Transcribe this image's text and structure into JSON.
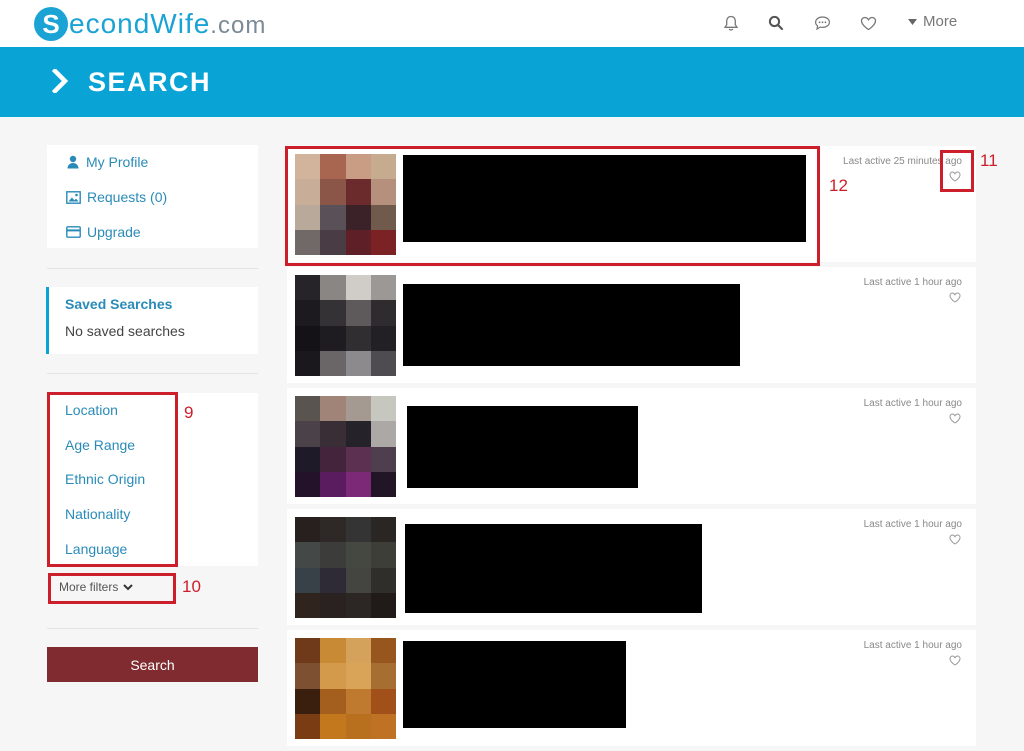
{
  "header": {
    "logo_letter": "S",
    "logo_text": "econdWife",
    "logo_suffix": ".com",
    "icons": [
      "bell-icon",
      "search-icon",
      "chat-icon",
      "heart-icon"
    ],
    "more_label": "More"
  },
  "banner": {
    "title": "SEARCH"
  },
  "sidebar": {
    "links": [
      {
        "label": "My Profile",
        "icon": "user-icon"
      },
      {
        "label": "Requests (0)",
        "icon": "image-icon"
      },
      {
        "label": "Upgrade",
        "icon": "card-icon"
      }
    ],
    "saved": {
      "title": "Saved Searches",
      "empty_text": "No saved searches"
    },
    "filters": [
      "Location",
      "Age Range",
      "Ethnic Origin",
      "Nationality",
      "Language"
    ],
    "more_filters_label": "More filters",
    "search_button": "Search"
  },
  "results": [
    {
      "last_active": "Last active 25 minutes ago",
      "thumb_colors": [
        "#d2b49c",
        "#a8654f",
        "#c89d84",
        "#c6ab8e",
        "#c8ad98",
        "#8b5548",
        "#6b2a2c",
        "#b4907d",
        "#b8a99b",
        "#5a5058",
        "#3a2228",
        "#705a4c",
        "#716868",
        "#4a3c44",
        "#5e2026",
        "#7a2224"
      ]
    },
    {
      "last_active": "Last active 1 hour ago",
      "thumb_colors": [
        "#262428",
        "#8a8684",
        "#d0ccc8",
        "#9c9896",
        "#1c1a1e",
        "#343234",
        "#5e5a5c",
        "#2e2c2e",
        "#141216",
        "#1e1c20",
        "#302e30",
        "#222024",
        "#1a181c",
        "#6a6668",
        "#8c8a8c",
        "#4e4c50"
      ]
    },
    {
      "last_active": "Last active 1 hour ago",
      "thumb_colors": [
        "#5a5450",
        "#a08478",
        "#a49a92",
        "#c6c8c0",
        "#4a4248",
        "#3a2e36",
        "#26222a",
        "#aca8a6",
        "#1e1a28",
        "#44243c",
        "#5c3050",
        "#4e3e4e",
        "#24122a",
        "#5a1c5e",
        "#7c2a78",
        "#221626"
      ]
    },
    {
      "last_active": "Last active 1 hour ago",
      "thumb_colors": [
        "#28201e",
        "#2e2826",
        "#343434",
        "#2a2624",
        "#444846",
        "#3c3c3a",
        "#444840",
        "#3e3e38",
        "#384048",
        "#2e2a36",
        "#444440",
        "#302e2a",
        "#30241e",
        "#2a2220",
        "#2c2624",
        "#201a18"
      ]
    },
    {
      "last_active": "Last active 1 hour ago",
      "thumb_colors": [
        "#6e3a1a",
        "#c88a34",
        "#d4a25a",
        "#96561e",
        "#7c5030",
        "#d49a4c",
        "#daa458",
        "#a66e30",
        "#3a1e0e",
        "#a45e1e",
        "#c07a30",
        "#a05018",
        "#7a3c12",
        "#c4781e",
        "#b8701e",
        "#c07224"
      ]
    }
  ],
  "annotations": [
    "9",
    "10",
    "11",
    "12"
  ],
  "colors": {
    "brand": "#0aa3d6",
    "link": "#2a8bb8",
    "search_button": "#7f2b30",
    "annotation": "#cc1f2b"
  }
}
